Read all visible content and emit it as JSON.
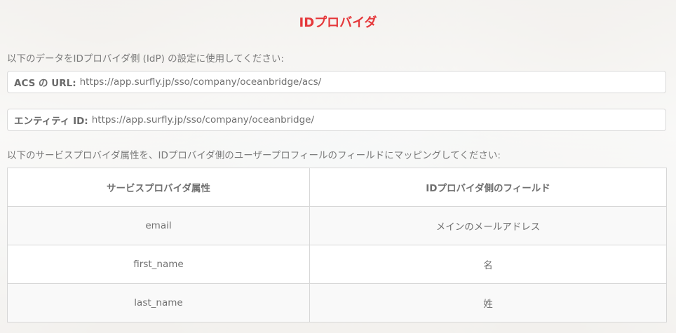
{
  "page": {
    "title": "IDプロバイダ",
    "intro_config": "以下のデータをIDプロバイダ側 (IdP) の設定に使用してください:",
    "acs": {
      "label": "ACS の URL:",
      "value": "https://app.surfly.jp/sso/company/oceanbridge/acs/"
    },
    "entity": {
      "label": "エンティティ ID:",
      "value": "https://app.surfly.jp/sso/company/oceanbridge/"
    },
    "intro_mapping": "以下のサービスプロバイダ属性を、IDプロバイダ側のユーザープロフィールのフィールドにマッピングしてください:"
  },
  "mapping_table": {
    "headers": [
      "サービスプロバイダ属性",
      "IDプロバイダ側のフィールド"
    ],
    "rows": [
      {
        "attribute": "email",
        "field": "メインのメールアドレス"
      },
      {
        "attribute": "first_name",
        "field": "名"
      },
      {
        "attribute": "last_name",
        "field": "姓"
      }
    ]
  },
  "colors": {
    "title": "#e5383b",
    "text": "#707070",
    "border": "#d7d7d7"
  }
}
